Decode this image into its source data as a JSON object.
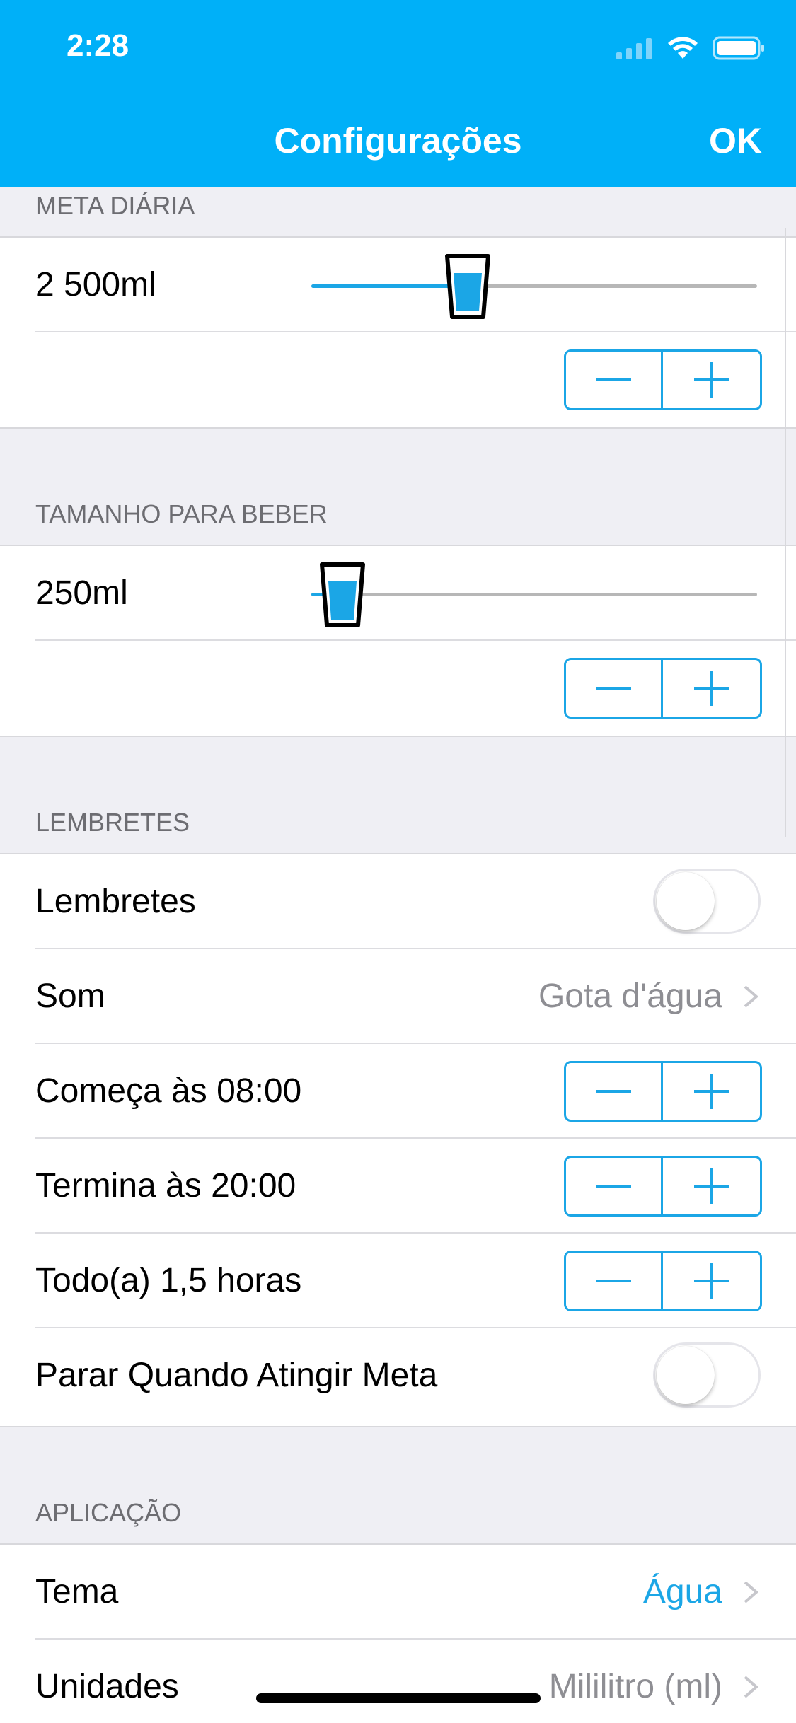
{
  "status_bar": {
    "time": "2:28",
    "icons": [
      "signal-icon",
      "wifi-icon",
      "battery-icon"
    ]
  },
  "nav": {
    "title": "Configurações",
    "ok_label": "OK"
  },
  "daily_goal": {
    "header": "META DIÁRIA",
    "value": "2 500ml",
    "slider_fraction": 0.35
  },
  "drink_size": {
    "header": "TAMANHO PARA BEBER",
    "value": "250ml",
    "slider_fraction": 0.07
  },
  "reminders": {
    "header": "LEMBRETES",
    "reminders_label": "Lembretes",
    "reminders_on": false,
    "sound_label": "Som",
    "sound_value": "Gota d'água",
    "starts_label": "Começa às 08:00",
    "ends_label": "Termina às 20:00",
    "every_label": "Todo(a) 1,5 horas",
    "stop_label": "Parar Quando Atingir Meta",
    "stop_on": false
  },
  "application": {
    "header": "APLICAÇÃO",
    "theme_label": "Tema",
    "theme_value": "Água",
    "units_label": "Unidades",
    "units_value": "Mililitro (ml)"
  },
  "colors": {
    "accent": "#1ba6e6",
    "header": "#00b0f8",
    "background": "#efeff4"
  }
}
